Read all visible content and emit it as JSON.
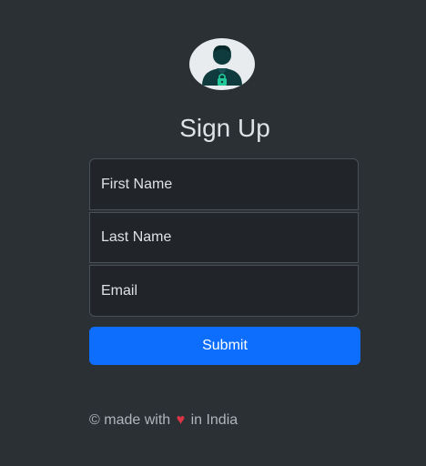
{
  "logo": {
    "icon": "user-avatar-icon"
  },
  "title": "Sign Up",
  "form": {
    "first_name_placeholder": "First Name",
    "last_name_placeholder": "Last Name",
    "email_placeholder": "Email",
    "submit_label": "Submit"
  },
  "footer": {
    "prefix": "© made with",
    "heart": "♥",
    "suffix": "in India"
  },
  "colors": {
    "background": "#2b3035",
    "input_background": "#212529",
    "primary": "#0d6efd",
    "heart": "#dc3545"
  }
}
